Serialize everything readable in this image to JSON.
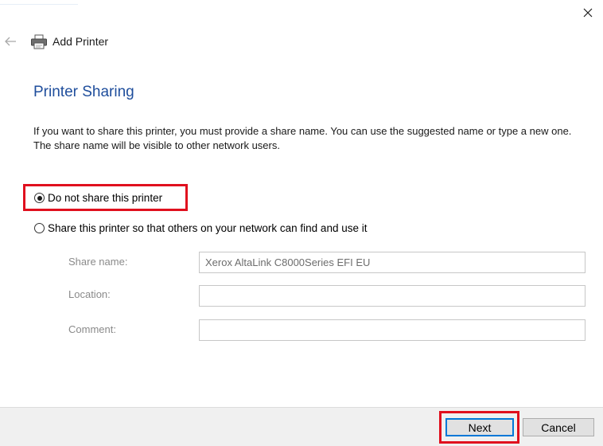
{
  "window": {
    "close_icon": "close-icon",
    "back_icon": "back-arrow-icon",
    "header_icon": "printer-icon",
    "header_title": "Add Printer"
  },
  "main": {
    "title": "Printer Sharing",
    "description": "If you want to share this printer, you must provide a share name. You can use the suggested name or type a new one. The share name will be visible to other network users.",
    "options": [
      {
        "label": "Do not share this printer",
        "selected": true
      },
      {
        "label": "Share this printer so that others on your network can find and use it",
        "selected": false
      }
    ],
    "fields": {
      "share_name": {
        "label": "Share name:",
        "value": "Xerox AltaLink C8000Series EFI EU"
      },
      "location": {
        "label": "Location:",
        "value": ""
      },
      "comment": {
        "label": "Comment:",
        "value": ""
      }
    }
  },
  "footer": {
    "next_label": "Next",
    "cancel_label": "Cancel"
  },
  "colors": {
    "title_blue": "#1f4e9c",
    "highlight_red": "#e0101e",
    "focus_blue": "#0078d7"
  }
}
